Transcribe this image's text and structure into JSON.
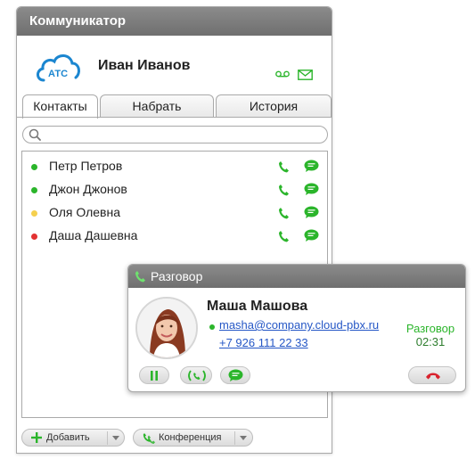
{
  "window": {
    "title": "Коммуникатор"
  },
  "profile": {
    "logo_text": "АТС",
    "name": "Иван Иванов",
    "icons": [
      "voicemail-icon",
      "mail-icon"
    ]
  },
  "tabs": [
    {
      "label": "Контакты",
      "active": true
    },
    {
      "label": "Набрать",
      "active": false
    },
    {
      "label": "История",
      "active": false
    }
  ],
  "search": {
    "placeholder": "",
    "value": ""
  },
  "contacts": [
    {
      "name": "Петр Петров",
      "status_color": "#2bb52b"
    },
    {
      "name": "Джон Джонов",
      "status_color": "#2bb52b"
    },
    {
      "name": "Оля Олевна",
      "status_color": "#f5d04e"
    },
    {
      "name": "Даша Дашевна",
      "status_color": "#e33232"
    }
  ],
  "footer": {
    "add_label": "Добавить",
    "conference_label": "Конференция"
  },
  "call": {
    "title": "Разговор",
    "caller_name": "Маша Машова",
    "email": "masha@company.cloud-pbx.ru",
    "phone": "+7 926 111 22 33",
    "status_label": "Разговор",
    "duration": "02:31",
    "status_color": "#2bb52b"
  },
  "colors": {
    "accent_green": "#2bb52b",
    "link_blue": "#2557c6",
    "hangup_red": "#d9232e",
    "title_bar": "#7d7d7d",
    "logo_blue": "#1b86d0"
  }
}
